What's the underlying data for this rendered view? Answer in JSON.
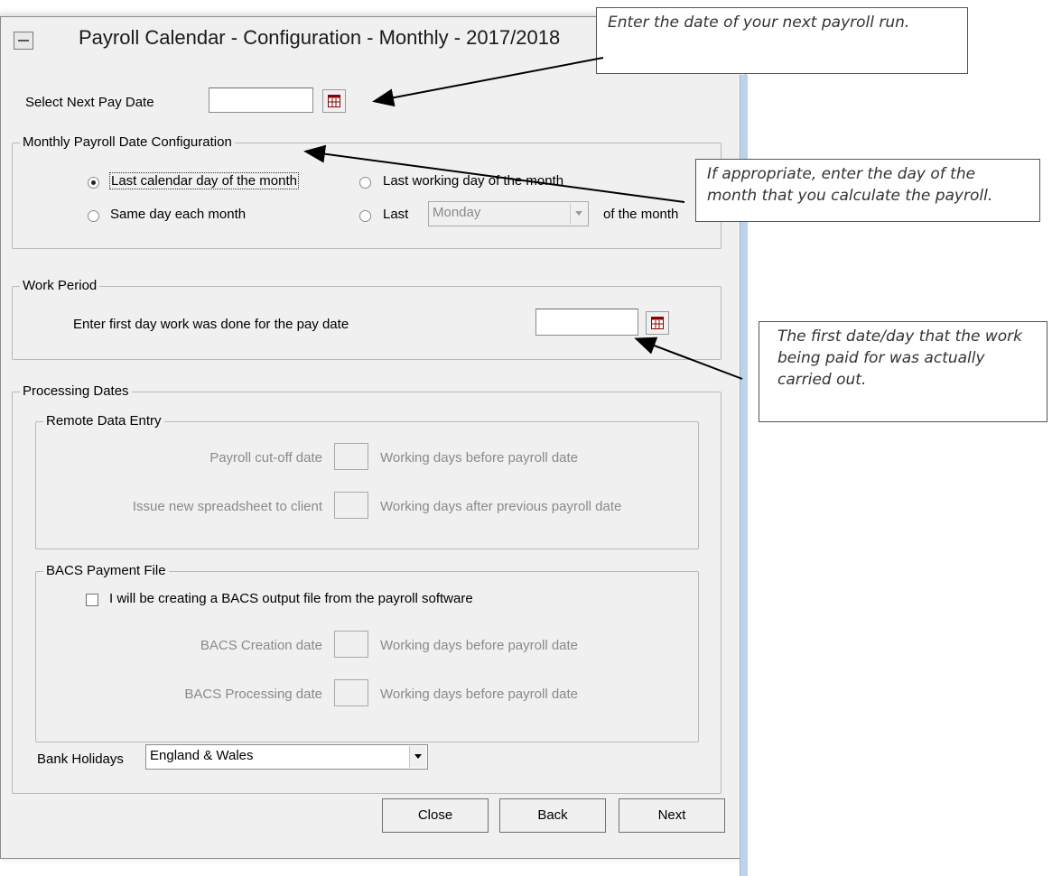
{
  "window": {
    "title": "Payroll Calendar - Configuration - Monthly - 2017/2018"
  },
  "next_pay_date": {
    "label": "Select Next Pay Date",
    "value": ""
  },
  "monthly_config": {
    "group_label": "Monthly Payroll Date Configuration",
    "options": {
      "last_calendar_day": "Last calendar day of the month",
      "last_working_day": "Last working day of the month",
      "same_day": "Same day each month",
      "last_weekday_prefix": "Last",
      "last_weekday_suffix": "of the month"
    },
    "selected": "last_calendar_day",
    "weekday_value": "Monday"
  },
  "work_period": {
    "group_label": "Work Period",
    "label": "Enter first day work was done for the pay date",
    "value": ""
  },
  "processing": {
    "group_label": "Processing Dates",
    "remote": {
      "group_label": "Remote Data Entry",
      "cutoff_label": "Payroll cut-off date",
      "cutoff_suffix": "Working days before payroll date",
      "issue_label": "Issue new spreadsheet to client",
      "issue_suffix": "Working days after previous payroll date"
    },
    "bacs": {
      "group_label": "BACS Payment File",
      "checkbox_label": "I will be creating a BACS output file from the payroll software",
      "checked": false,
      "creation_label": "BACS Creation date",
      "creation_suffix": "Working days before payroll date",
      "processing_label": "BACS Processing date",
      "processing_suffix": "Working days before payroll date"
    },
    "bank_holidays": {
      "label": "Bank Holidays",
      "value": "England & Wales"
    }
  },
  "buttons": {
    "close": "Close",
    "back": "Back",
    "next": "Next"
  },
  "callouts": {
    "next_pay_date": "Enter the date of your next payroll run.",
    "day_of_month": "If appropriate, enter the day of the month that you calculate the payroll.",
    "first_day": "The first date/day that the work being paid for was actually carried out."
  }
}
